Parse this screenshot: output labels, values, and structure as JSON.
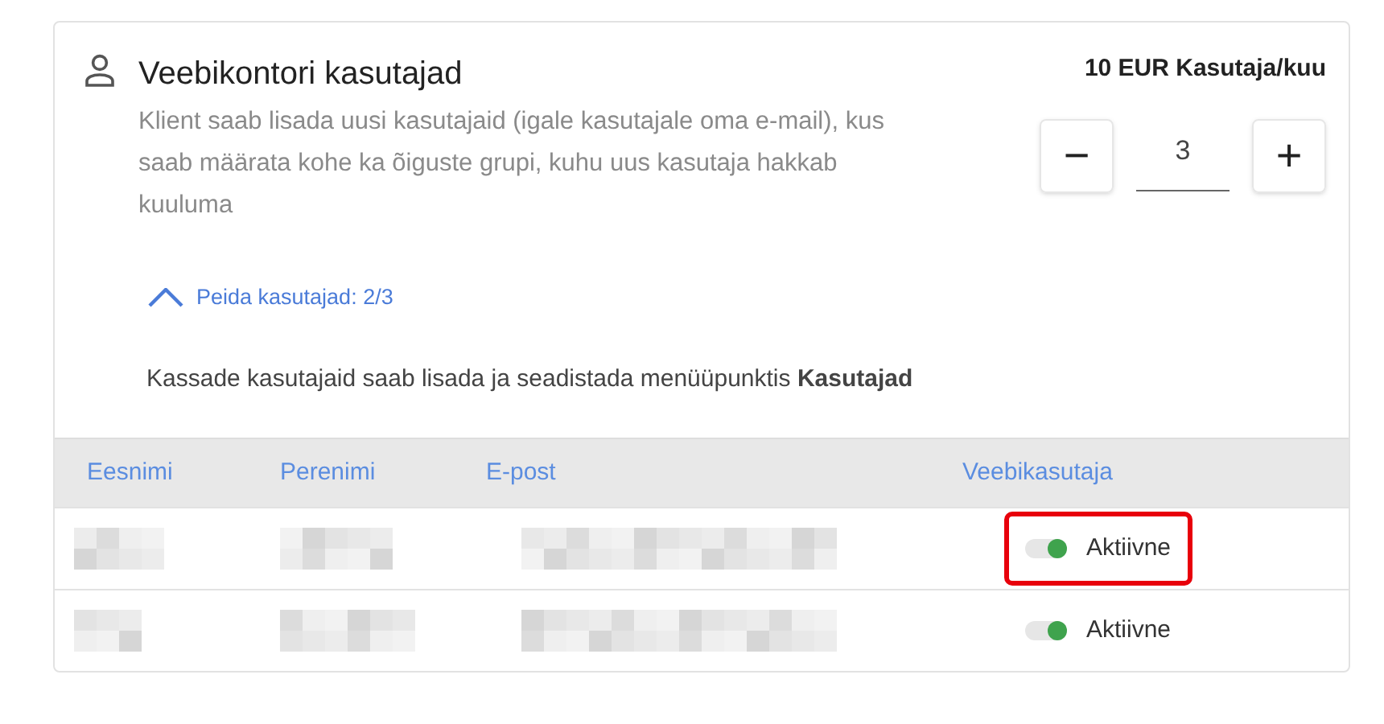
{
  "section": {
    "title": "Veebikontori kasutajad",
    "description": "Klient saab lisada uusi kasutajaid (igale kasutajale oma e-mail), kus saab määrata kohe ka õiguste grupi, kuhu uus kasutaja hakkab kuuluma",
    "price": "10 EUR Kasutaja/kuu",
    "stepper": {
      "minus": "−",
      "value": "3",
      "plus": "+"
    }
  },
  "toggle_link": {
    "label": "Peida kasutajad: 2/3",
    "expanded": true
  },
  "note": "Kassade kasutajaid saab lisada ja seadistada menüüpunktis **Kasutajad**",
  "table": {
    "columns": [
      "Eesnimi",
      "Perenimi",
      "E-post",
      "Veebikasutaja"
    ],
    "rows": [
      {
        "on": true,
        "status": "Aktiivne",
        "highlighted": true
      },
      {
        "on": true,
        "status": "Aktiivne",
        "highlighted": false
      }
    ]
  }
}
